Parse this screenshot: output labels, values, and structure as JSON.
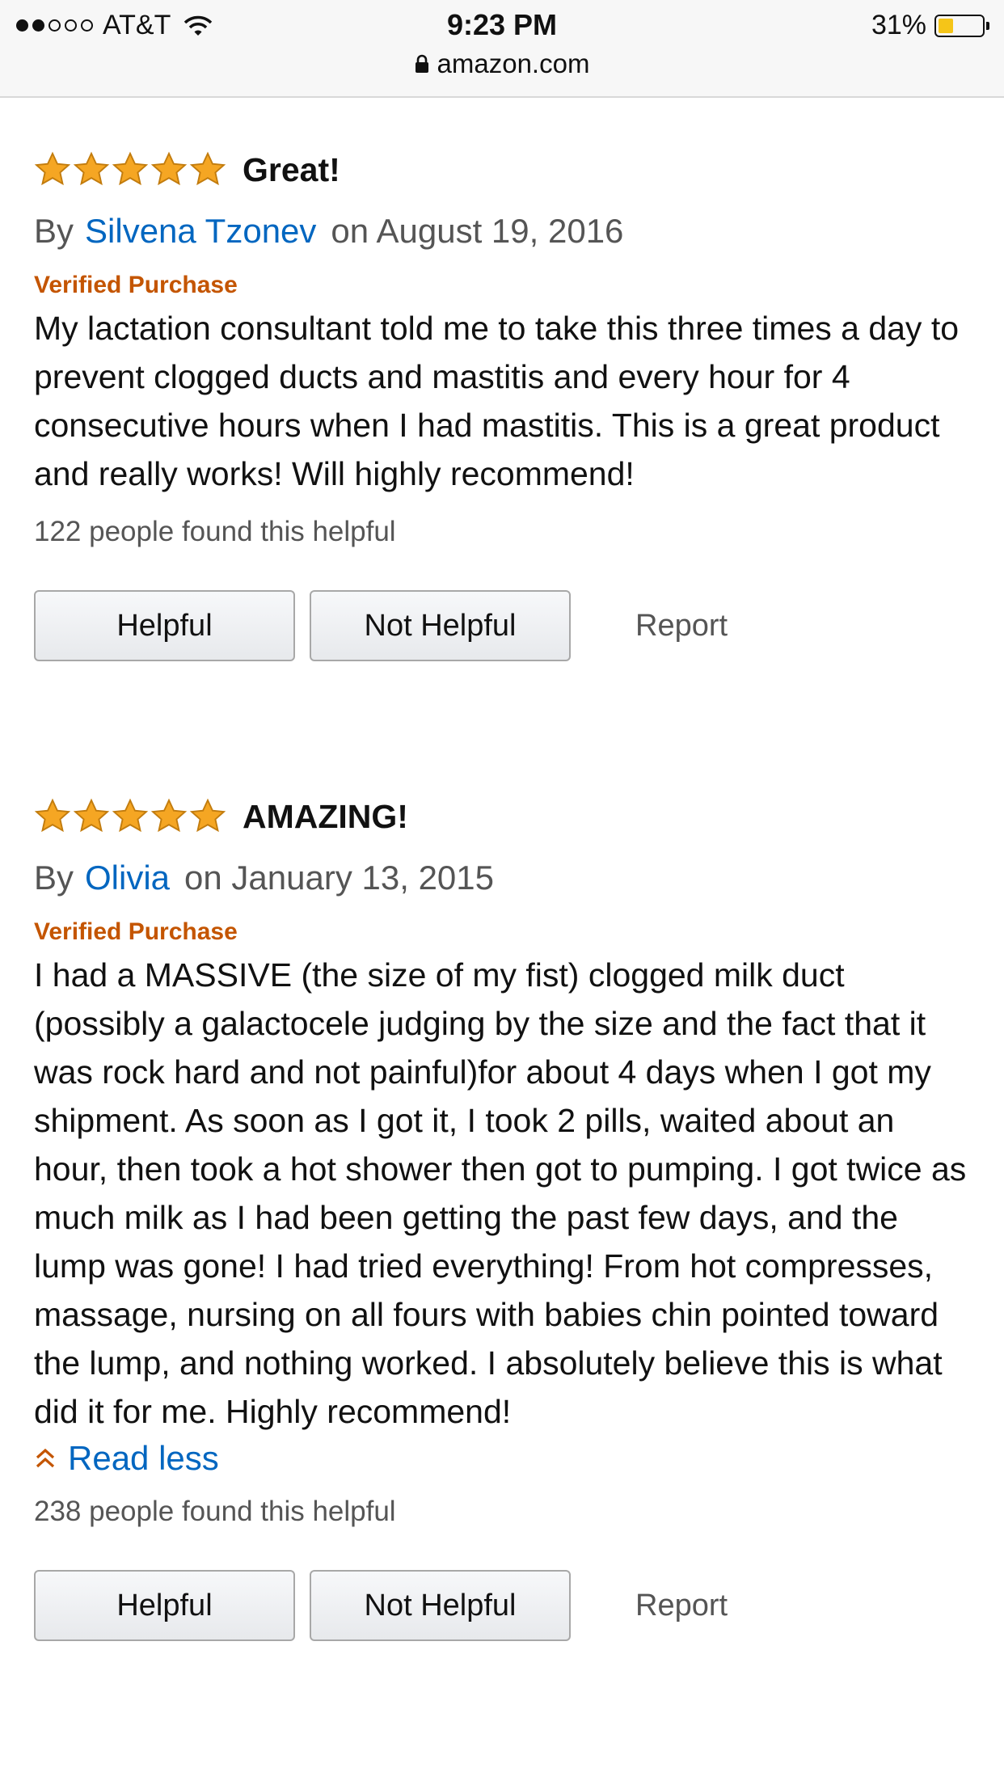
{
  "status": {
    "carrier": "AT&T",
    "time": "9:23 PM",
    "battery_pct": "31%",
    "battery_level": 0.31,
    "url": "amazon.com"
  },
  "reviews": [
    {
      "rating": 5,
      "title": "Great!",
      "by": "By",
      "author": "Silvena Tzonev",
      "date": "on August 19, 2016",
      "verified": "Verified Purchase",
      "body": "My lactation consultant told me to take this three times a day to prevent clogged ducts and mastitis and every hour for 4 consecutive hours when I had mastitis. This is a great product and really works! Will highly recommend!",
      "helpful_count": "122 people found this helpful",
      "helpful_label": "Helpful",
      "not_helpful_label": "Not Helpful",
      "report_label": "Report"
    },
    {
      "rating": 5,
      "title": "AMAZING!",
      "by": "By",
      "author": "Olivia",
      "date": "on January 13, 2015",
      "verified": "Verified Purchase",
      "body": "I had a MASSIVE (the size of my fist) clogged milk duct (possibly a galactocele judging by the size and the fact that it was rock hard and not painful)for about 4 days when I got my shipment. As soon as I got it, I took 2 pills, waited about an hour, then took a hot shower then got to pumping. I got twice as much milk as I had been getting the past few days, and the lump was gone! I had tried everything! From hot compresses, massage, nursing on all fours with babies chin pointed toward the lump, and nothing worked. I absolutely believe this is what did it for me. Highly recommend!",
      "read_less": "Read less",
      "helpful_count": "238 people found this helpful",
      "helpful_label": "Helpful",
      "not_helpful_label": "Not Helpful",
      "report_label": "Report"
    }
  ],
  "colors": {
    "star": "#f5a623",
    "link": "#0066c0",
    "verified": "#c45500"
  }
}
